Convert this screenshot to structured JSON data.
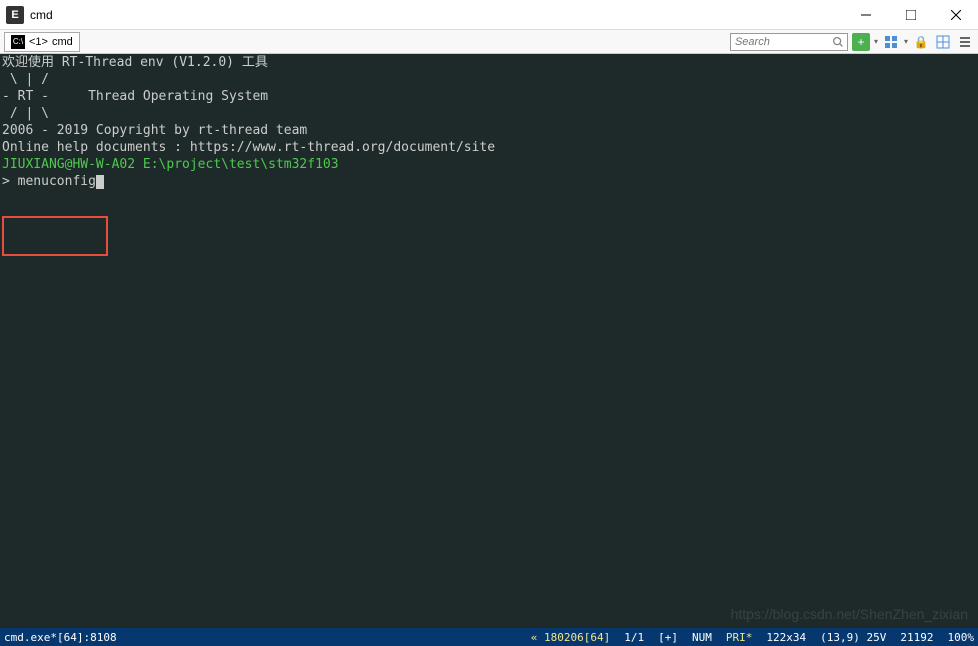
{
  "titlebar": {
    "icon_letter": "E",
    "title": "cmd"
  },
  "toolbar": {
    "tab": {
      "number": "<1>",
      "label": "cmd"
    },
    "search_placeholder": "Search"
  },
  "terminal": {
    "lines": [
      "欢迎使用 RT-Thread env (V1.2.0) 工具",
      " \\ | /",
      "- RT -     Thread Operating System",
      " / | \\",
      "2006 - 2019 Copyright by rt-thread team",
      "Online help documents : https://www.rt-thread.org/document/site",
      "",
      ""
    ],
    "prompt_user": "JIUXIANG@HW-W-A02",
    "prompt_path": "E:\\project\\test\\stm32f103",
    "prompt_char": ">",
    "command": "menuconfig",
    "watermark": "https://blog.csdn.net/ShenZhen_zixian"
  },
  "statusbar": {
    "process": "cmd.exe*[64]:8108",
    "encoding": "« 180206[64]",
    "position": "1/1",
    "plus": "[+]",
    "num": "NUM",
    "pri_star": "PRI*",
    "size": "122x34",
    "cursor": "(13,9) 25V",
    "pid": "21192",
    "zoom": "100%"
  }
}
